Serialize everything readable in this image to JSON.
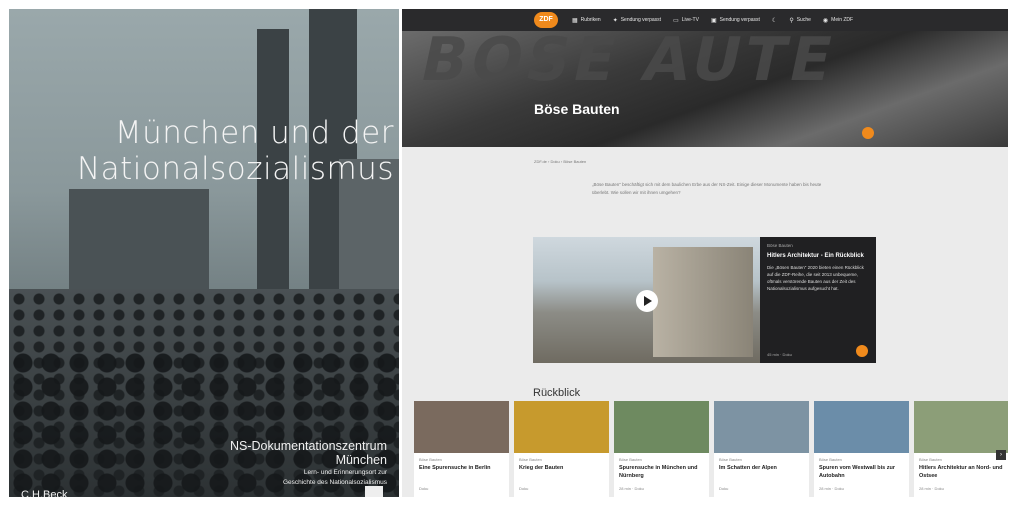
{
  "cover": {
    "title_line1": "München und der",
    "title_line2": "Nationalsozialismus",
    "institution": "NS-Dokumentationszentrum",
    "city": "München",
    "subtitle_line1": "Lern- und Erinnerungsort zur",
    "subtitle_line2": "Geschichte des Nationalsozialismus",
    "publisher": "C.H.Beck"
  },
  "zdf": {
    "logo": "ZDF",
    "nav": [
      "Rubriken",
      "Sendung verpasst",
      "Live-TV",
      "Sendung verpasst",
      "Suche",
      "Mein ZDF"
    ],
    "hero_title": "Böse Bauten",
    "breadcrumb": "ZDF.de  ›  Doku  ›  Böse Bauten",
    "intro": "„Böse Bauten\" beschäftigt sich mit dem baulichen Erbe aus der NS-Zeit. Einige dieser Monumente haben bis heute überlebt. Wie sollen wir mit ihnen umgehen?",
    "feature": {
      "kicker": "Böse Bauten",
      "title": "Hitlers Architektur - Ein Rückblick",
      "description": "Die „Bösen Bauten\" 2020 bieten einen Rückblick auf die ZDF-Reihe, die seit 2013 unbequeme, oftmals verstörende Bauten aus der Zeit des Nationalsozialismus aufgesucht hat.",
      "meta": "45 min · Doku"
    },
    "section_title": "Rückblick",
    "cards": [
      {
        "kicker": "Böse Bauten",
        "title": "Eine Spurensuche in Berlin",
        "meta": "Doku",
        "color": "#7a6a5e"
      },
      {
        "kicker": "Böse Bauten",
        "title": "Krieg der Bauten",
        "meta": "Doku",
        "color": "#c79a2d"
      },
      {
        "kicker": "Böse Bauten",
        "title": "Spurensuche in München und Nürnberg",
        "meta": "28 min · Doku",
        "color": "#6e8a60"
      },
      {
        "kicker": "Böse Bauten",
        "title": "Im Schatten der Alpen",
        "meta": "Doku",
        "color": "#7d93a3"
      },
      {
        "kicker": "Böse Bauten",
        "title": "Spuren vom Westwall bis zur Autobahn",
        "meta": "28 min · Doku",
        "color": "#6b8da9"
      },
      {
        "kicker": "Böse Bauten",
        "title": "Hitlers Architektur an Nord- und Ostsee",
        "meta": "28 min · Doku",
        "color": "#8c9e78"
      }
    ]
  }
}
